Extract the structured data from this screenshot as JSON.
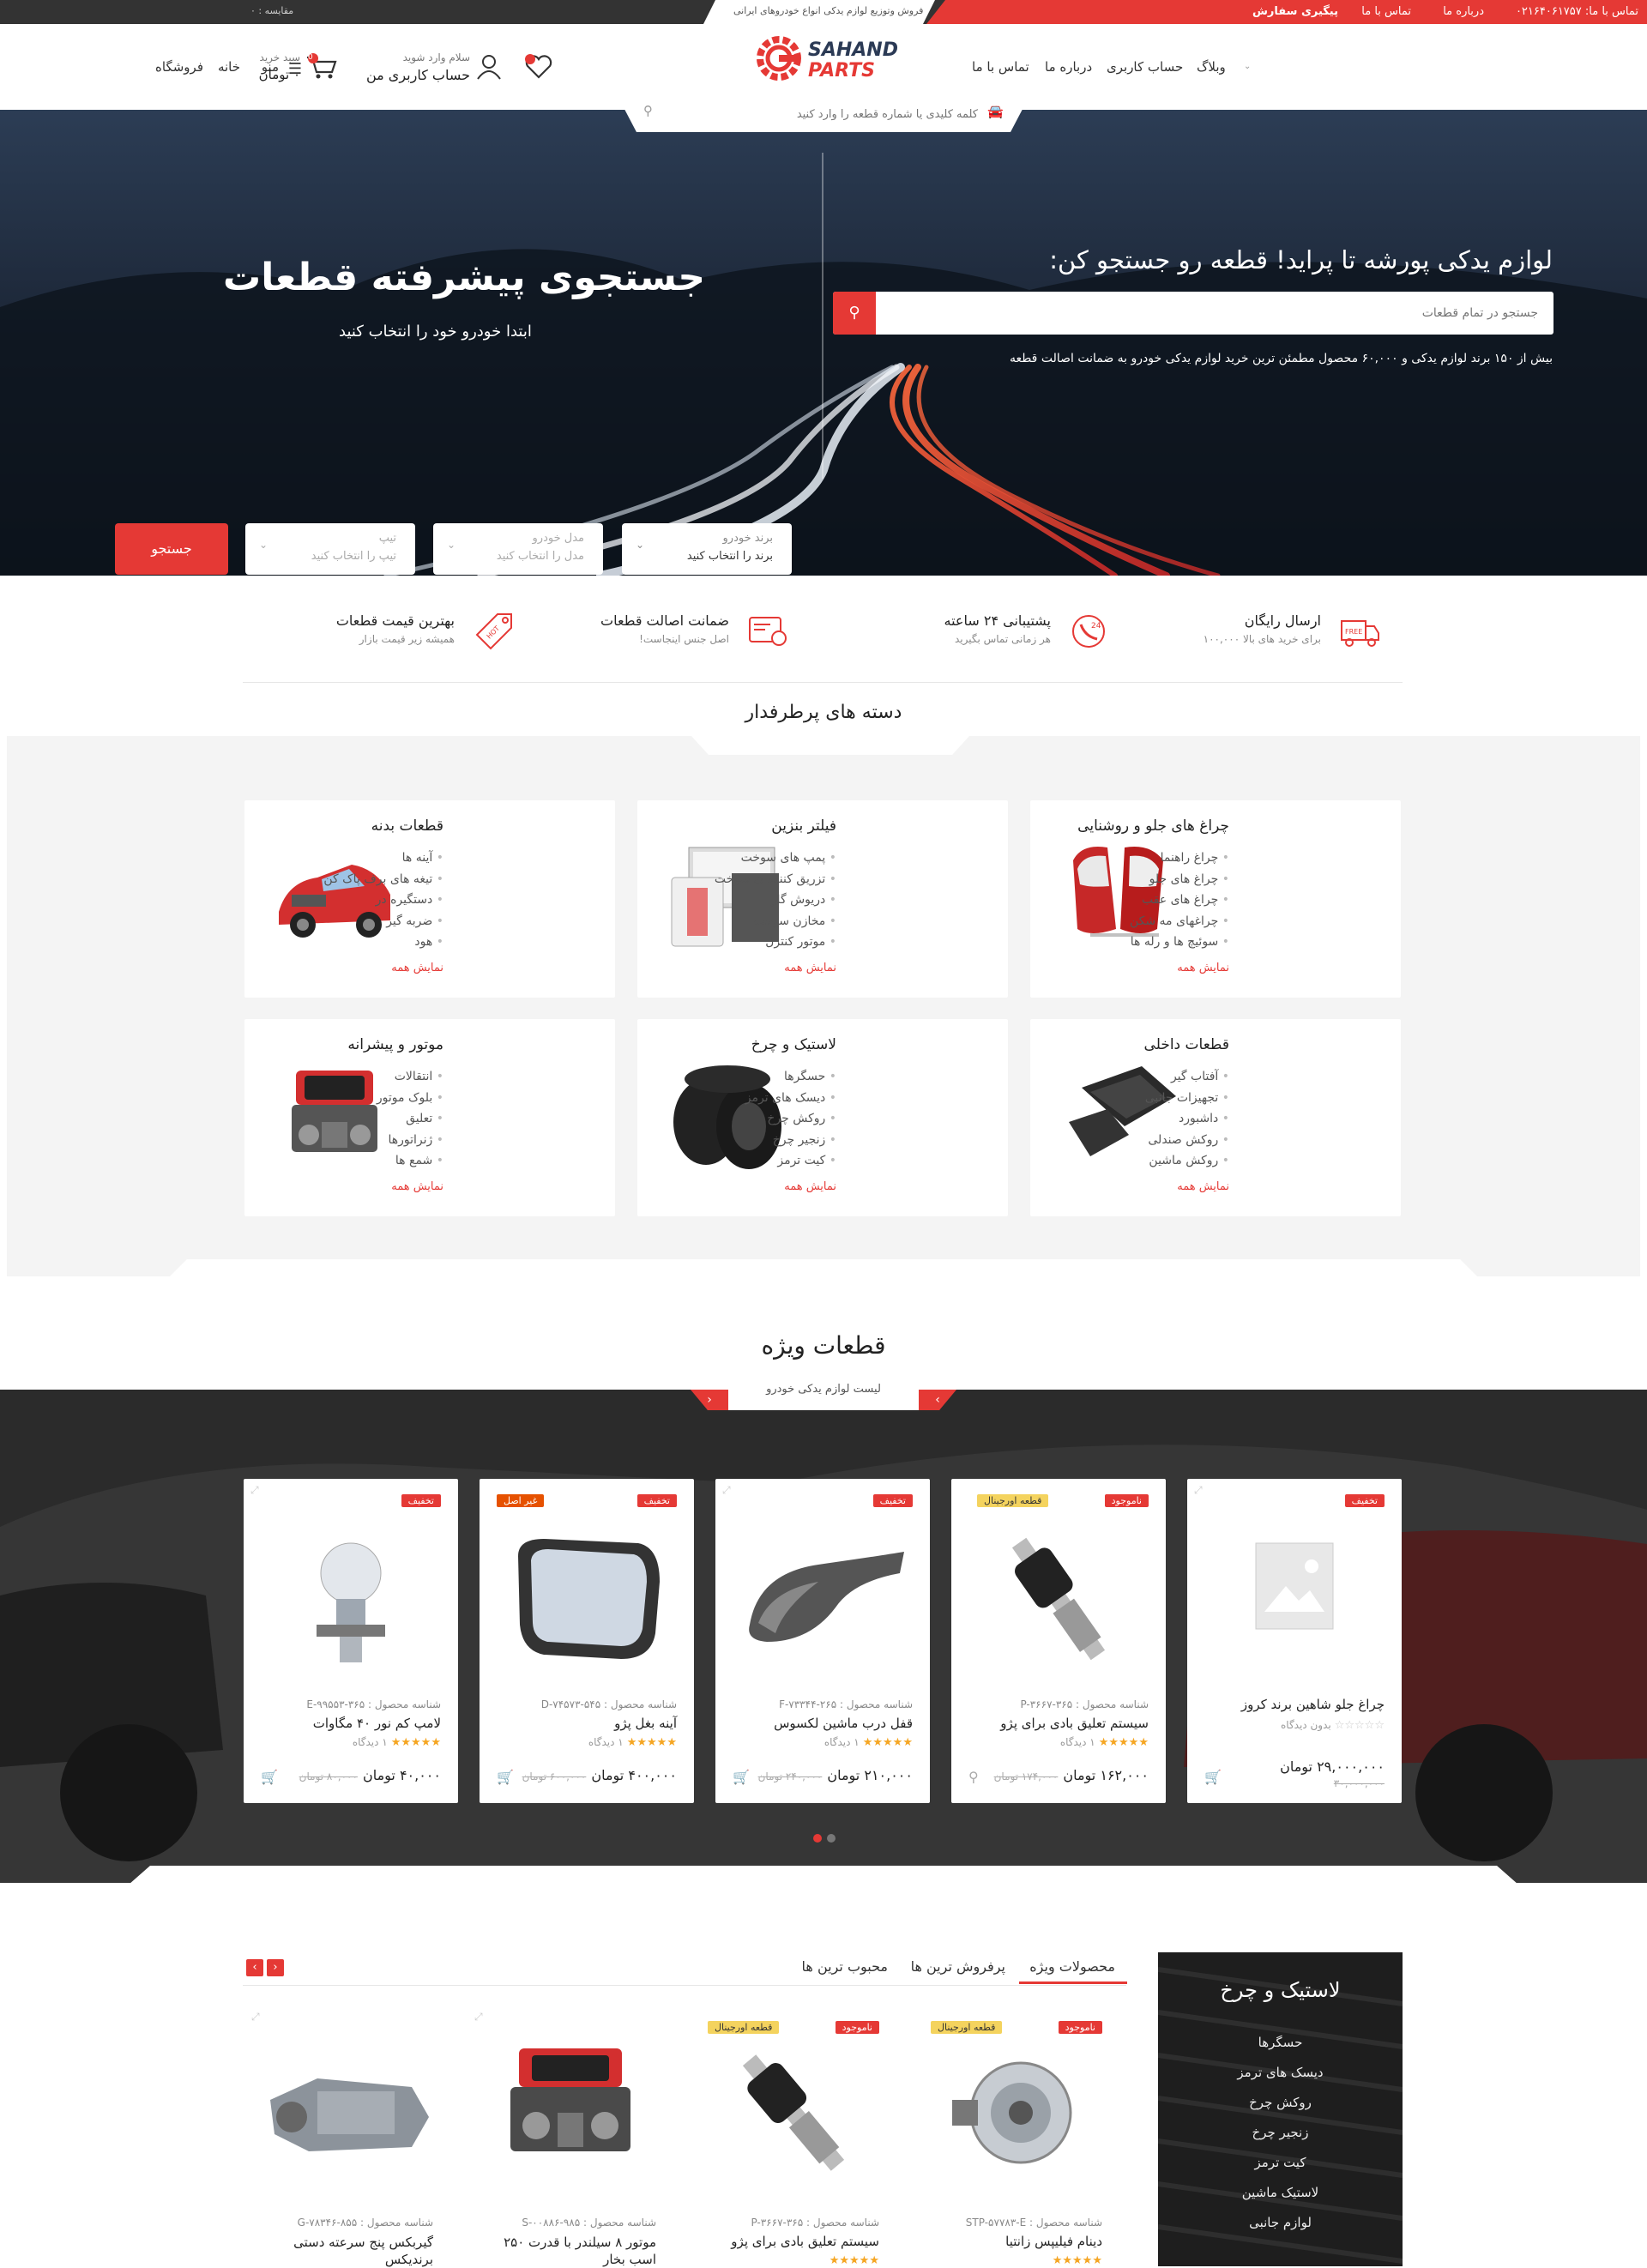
{
  "topbar": {
    "phone": "تماس با ما: ۰۲۱۶۴۰۶۱۷۵۷",
    "about": "درباره ما",
    "contact": "تماس با ما",
    "track": "پیگیری سفارش",
    "tagline": "فروش وتوزیع لوازم یدکی انواع خودروهای ایرانی",
    "compare": "مقایسه : ۰"
  },
  "header": {
    "logo_top": "SAHAND",
    "logo_bottom": "PARTS",
    "nav": [
      "منو",
      "خانه",
      "فروشگاه",
      "وبلاگ",
      "حساب کاربری",
      "درباره ما",
      "تماس با ما"
    ],
    "account_greeting": "سلام وارد شوید",
    "account_label": "حساب کاربری من",
    "cart_label": "سبد خرید",
    "cart_total": "۰ تومان",
    "cart_count": "0",
    "search_placeholder": "کلمه کلیدی یا شماره قطعه را وارد کنید"
  },
  "hero": {
    "heading_right": "لوازم یدکی پورشه تا پراید! قطعه رو جستجو کن:",
    "search_placeholder": "جستجو در تمام قطعات",
    "subtext": "بیش از ۱۵۰ برند لوازم یدکی و ۶۰,۰۰۰ محصول مطمئن ترین خرید لوازم یدکی خودرو به ضمانت اصالت قطعه",
    "heading_left": "جستجوی پیشرفته قطعات",
    "sub_left": "ابتدا خودرو خود را انتخاب کنید",
    "selects": [
      {
        "label": "برند خودرو",
        "value": "برند را انتخاب کنید"
      },
      {
        "label": "مدل خودرو",
        "value": "مدل را انتخاب کنید"
      },
      {
        "label": "تیپ",
        "value": "تیپ را انتخاب کنید"
      }
    ],
    "search_button": "جستجو"
  },
  "features": [
    {
      "title": "ارسال رایگان",
      "sub": "برای خرید های بالا ۱۰۰,۰۰۰",
      "icon": "free-delivery-icon"
    },
    {
      "title": "پشتیبانی ۲۴ ساعته",
      "sub": "هر زمانی تماس بگیرید",
      "icon": "support-icon"
    },
    {
      "title": "ضمانت اصالت قطعات",
      "sub": "اصل جنس اینجاست!",
      "icon": "guarantee-icon"
    },
    {
      "title": "بهترین قیمت قطعات",
      "sub": "همیشه زیر قیمت بازار",
      "icon": "hot-price-icon"
    }
  ],
  "categories_title": "دسته های پرطرفدار",
  "categories": [
    {
      "title": "چراغ های جلو و روشنایی",
      "items": [
        "چراغ راهنما",
        "چراغ های جلو",
        "چراغ های عقب",
        "چراغهای مه شکن",
        "سوئیچ ها و رله ها"
      ],
      "more": "نمایش همه",
      "image": "tail-light"
    },
    {
      "title": "فیلتر بنزین",
      "items": [
        "پمپ های سوخت",
        "تزریق کننده ی سوخت",
        "دریوش گاز",
        "مخازن سوخت",
        "موتور کنترل"
      ],
      "more": "نمایش همه",
      "image": "filters"
    },
    {
      "title": "قطعات بدنه",
      "items": [
        "آینه ها",
        "تیغه های برف پاک کن",
        "دستگیره در",
        "ضربه گیر",
        "هود"
      ],
      "more": "نمایش همه",
      "image": "car-body"
    },
    {
      "title": "قطعات داخلی",
      "items": [
        "آفتاب گیر",
        "تجهیزات جانبی",
        "داشبورد",
        "روکش صندلی",
        "روکش ماشین"
      ],
      "more": "نمایش همه",
      "image": "floor-mats"
    },
    {
      "title": "لاستیک و چرخ",
      "items": [
        "حسگرها",
        "دیسک های ترمز",
        "روکش چرخ",
        "زنجیر چرخ",
        "کیت ترمز"
      ],
      "more": "نمایش همه",
      "image": "tires"
    },
    {
      "title": "موتور و پیشرانه",
      "items": [
        "انتقالات",
        "بلوک موتور",
        "تعلیق",
        "ژنراتورها",
        "شمع ها"
      ],
      "more": "نمایش همه",
      "image": "engine"
    }
  ],
  "special": {
    "title": "قطعات ویژه",
    "subtitle": "لیست لوازم یدکی خودرو",
    "products": [
      {
        "badge": "تخفیف",
        "badge2": "",
        "sku": "",
        "name": "چراغ جلو شاهین برند کروز",
        "stars": "☆☆☆☆☆",
        "reviews": "بدون دیدگاه",
        "price": "۲۹,۰۰۰,۰۰۰ تومان",
        "old": "۳۰,۰۰۰,۰۰۰",
        "image": "placeholder"
      },
      {
        "badge": "ناموجود",
        "badge2": "قطعه اورجینال",
        "sku": "شناسه محصول : P-۳۶۶۷-۳۶۵",
        "name": "سیستم تعلیق بادی برای پژو",
        "stars": "★★★★★",
        "reviews": "۱ دیدگاه",
        "price": "۱۶۲,۰۰۰ تومان",
        "old": "۱۷۴,۰۰۰ تومان",
        "image": "shock"
      },
      {
        "badge": "تخفیف",
        "badge2": "",
        "sku": "شناسه محصول : F-۷۳۳۴۴-۲۶۵",
        "name": "قفل درب ماشین لکسوس",
        "stars": "★★★★★",
        "reviews": "۱ دیدگاه",
        "price": "۲۱۰,۰۰۰ تومان",
        "old": "۲۴۰,۰۰۰ تومان",
        "image": "handle"
      },
      {
        "badge": "تخفیف",
        "badge2": "غیر اصل",
        "sku": "شناسه محصول : D-۷۴۵۷۳-۵۴۵",
        "name": "آینه بغل پژو",
        "stars": "★★★★★",
        "reviews": "۱ دیدگاه",
        "price": "۴۰۰,۰۰۰ تومان",
        "old": "۶۰۰,۰۰۰ تومان",
        "image": "mirror"
      },
      {
        "badge": "تخفیف",
        "badge2": "",
        "sku": "شناسه محصول : E-۹۹۵۵۳-۳۶۵",
        "name": "لامپ کم نور ۴۰ مگاوات",
        "stars": "★★★★★",
        "reviews": "۱ دیدگاه",
        "price": "۴۰,۰۰۰ تومان",
        "old": "۸۰,۰۰۰ تومان",
        "image": "bulb"
      }
    ]
  },
  "bottom": {
    "side_title": "لاستیک و چرخ",
    "side_items": [
      "حسگرها",
      "دیسک های ترمز",
      "روکش چرخ",
      "زنجیر چرخ",
      "کیت ترمز",
      "لاستیک ماشین",
      "لوازم جانبی"
    ],
    "tabs": [
      "محصولات ویژه",
      "پرفروش ترین ها",
      "محبوب ترین ها"
    ],
    "products": [
      {
        "badge": "ناموجود",
        "badge2": "قطعه اورجینال",
        "sku": "شناسه محصول : STP-۵۷۷۸۳-E",
        "name": "دینام فیلیپس زانتیا",
        "stars": "★★★★★",
        "image": "alternator"
      },
      {
        "badge": "ناموجود",
        "badge2": "قطعه اورجینال",
        "sku": "شناسه محصول : P-۳۶۶۷-۳۶۵",
        "name": "سیستم تعلیق بادی برای پژو",
        "stars": "★★★★★",
        "image": "shock"
      },
      {
        "badge": "",
        "badge2": "",
        "sku": "شناسه محصول : S-۰۰۸۸۶-۹۸۵",
        "name": "موتور ۸ سیلندر با قدرت ۲۵۰ اسب بخار",
        "stars": "",
        "image": "engine"
      },
      {
        "badge": "",
        "badge2": "",
        "sku": "شناسه محصول : G-۷۸۳۴۶-۸۵۵",
        "name": "گیربکس پنج سرعته دستی برندیکس",
        "stars": "",
        "image": "gearbox"
      }
    ]
  },
  "colors": {
    "accent": "#e53935",
    "dark": "#333333"
  }
}
